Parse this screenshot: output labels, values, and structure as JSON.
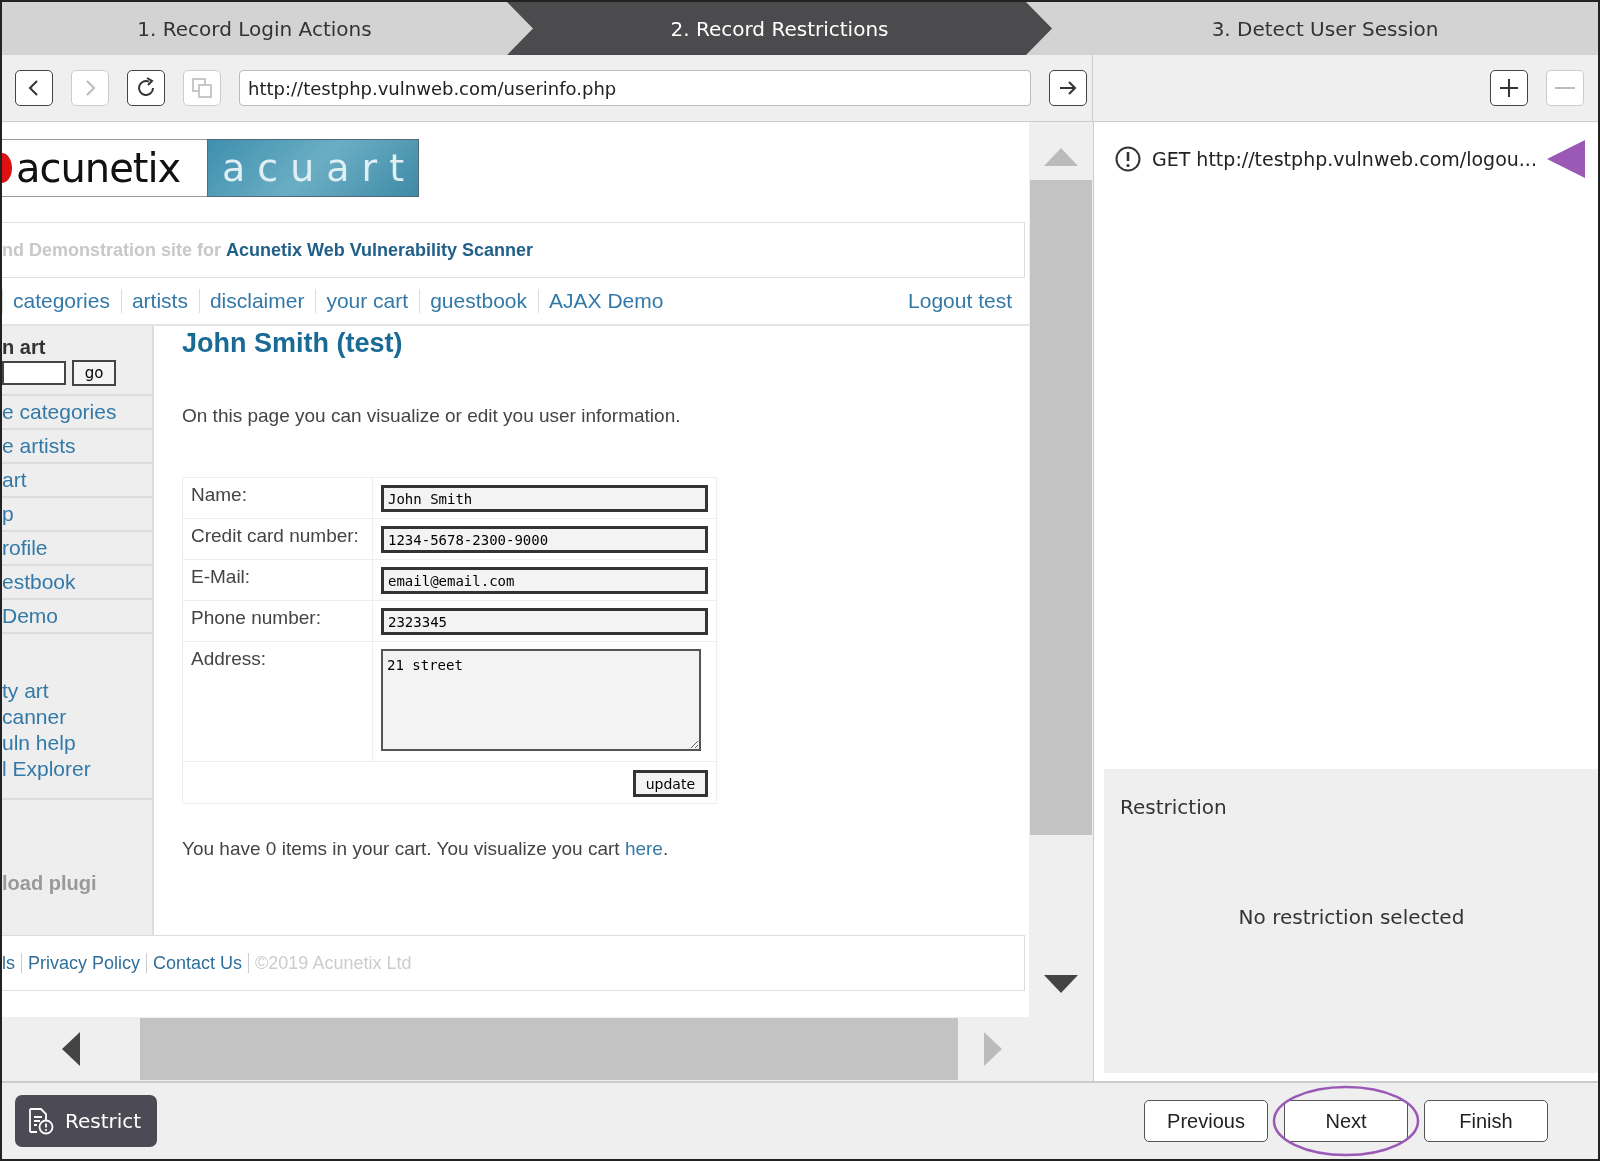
{
  "wizard_steps": [
    {
      "label": "1. Record Login Actions",
      "selected": false
    },
    {
      "label": "2. Record Restrictions",
      "selected": true
    },
    {
      "label": "3. Detect User Session",
      "selected": false
    }
  ],
  "browser": {
    "buttons": [
      {
        "kind": "back",
        "disabled": false
      },
      {
        "kind": "forward",
        "disabled": true
      },
      {
        "kind": "reload",
        "disabled": false
      },
      {
        "kind": "copy",
        "disabled": true
      }
    ],
    "address": "http://testphp.vulnweb.com/userinfo.php"
  },
  "page": {
    "logo_left": "acunetix",
    "logo_right": "acuart",
    "tagline": "nd Demonstration site for **Acunetix Web Vulnerability Scanner**",
    "nav": [
      "categories",
      "artists",
      "disclaimer",
      "your cart",
      "guestbook",
      "AJAX Demo"
    ],
    "logout": "Logout test",
    "sidebar": {
      "search_title": "n art",
      "go": "go",
      "links": [
        "e categories",
        "e artists",
        "art",
        "p",
        "rofile",
        "estbook",
        "Demo"
      ],
      "more_links": [
        "ty art",
        "canner",
        "uln help",
        "l Explorer"
      ],
      "plugin_note": "load plugi"
    },
    "heading": "John Smith (test)",
    "intro": "On this page you can visualize or edit you user information.",
    "form": [
      {
        "label": "Name:",
        "value": "John Smith",
        "kind": "input"
      },
      {
        "label": "Credit card number:",
        "value": "1234-5678-2300-9000",
        "kind": "input"
      },
      {
        "label": "E-Mail:",
        "value": "email@email.com",
        "kind": "input"
      },
      {
        "label": "Phone number:",
        "value": "2323345",
        "kind": "input"
      },
      {
        "label": "Address:",
        "value": "21 street",
        "kind": "textarea"
      }
    ],
    "update": "update",
    "cart_note": {
      "text": "You have 0 items in your cart. You visualize you cart ",
      "link": "here",
      "end": "."
    },
    "footer": [
      {
        "text": "ls",
        "kind": "link"
      },
      {
        "text": "Privacy Policy",
        "kind": "link"
      },
      {
        "text": "Contact Us",
        "kind": "link"
      },
      {
        "text": "©2019 Acunetix Ltd",
        "kind": "plain"
      }
    ]
  },
  "list_toolbar": {
    "add_disabled": false,
    "remove_disabled": true
  },
  "requests": [
    {
      "text": "GET http://testphp.vulnweb.com/logou...",
      "annotated": true
    }
  ],
  "restriction": {
    "title": "Restriction",
    "message": "No restriction selected"
  },
  "restrict_button": "Restrict",
  "nav_buttons": [
    {
      "label": "Previous",
      "annotated": false
    },
    {
      "label": "Next",
      "annotated": true
    },
    {
      "label": "Finish",
      "annotated": false
    }
  ]
}
